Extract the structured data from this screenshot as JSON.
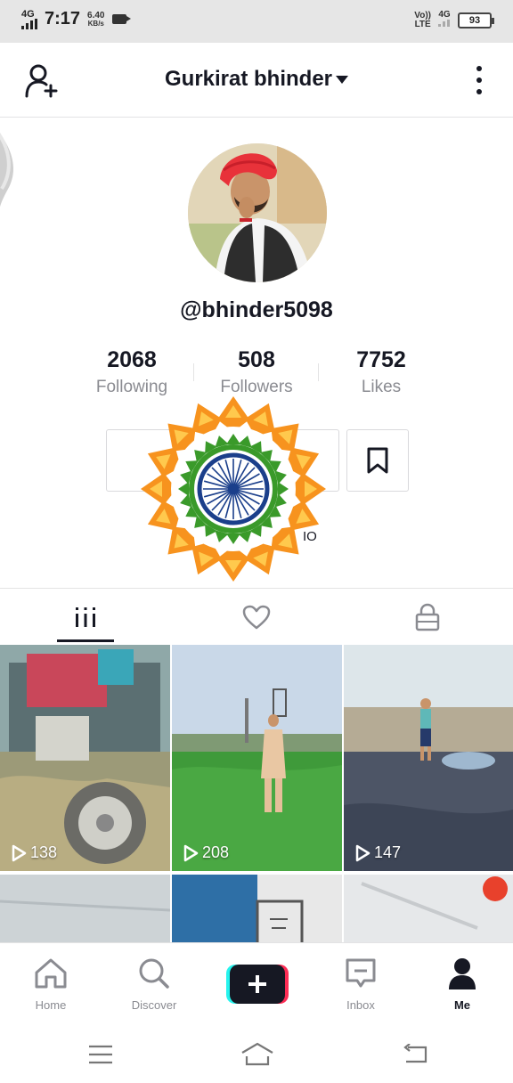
{
  "status_bar": {
    "network_left": "4G",
    "time": "7:17",
    "speed_value": "6.40",
    "speed_unit": "KB/s",
    "volte": "Vo))",
    "lte": "LTE",
    "network_right": "4G",
    "battery": "93"
  },
  "header": {
    "username": "Gurkirat bhinder"
  },
  "profile": {
    "handle": "@bhinder5098",
    "bio_fragment": "IO",
    "stats": [
      {
        "value": "2068",
        "label": "Following"
      },
      {
        "value": "508",
        "label": "Followers"
      },
      {
        "value": "7752",
        "label": "Likes"
      }
    ]
  },
  "videos": [
    {
      "views": "138"
    },
    {
      "views": "208"
    },
    {
      "views": "147"
    }
  ],
  "bottom_nav": {
    "home": "Home",
    "discover": "Discover",
    "inbox": "Inbox",
    "me": "Me"
  },
  "colors": {
    "saffron": "#F7931E",
    "green": "#3A9A2A",
    "chakra_blue": "#1B3F8B",
    "create_cyan": "#25F4EE",
    "create_pink": "#FE2C55"
  }
}
